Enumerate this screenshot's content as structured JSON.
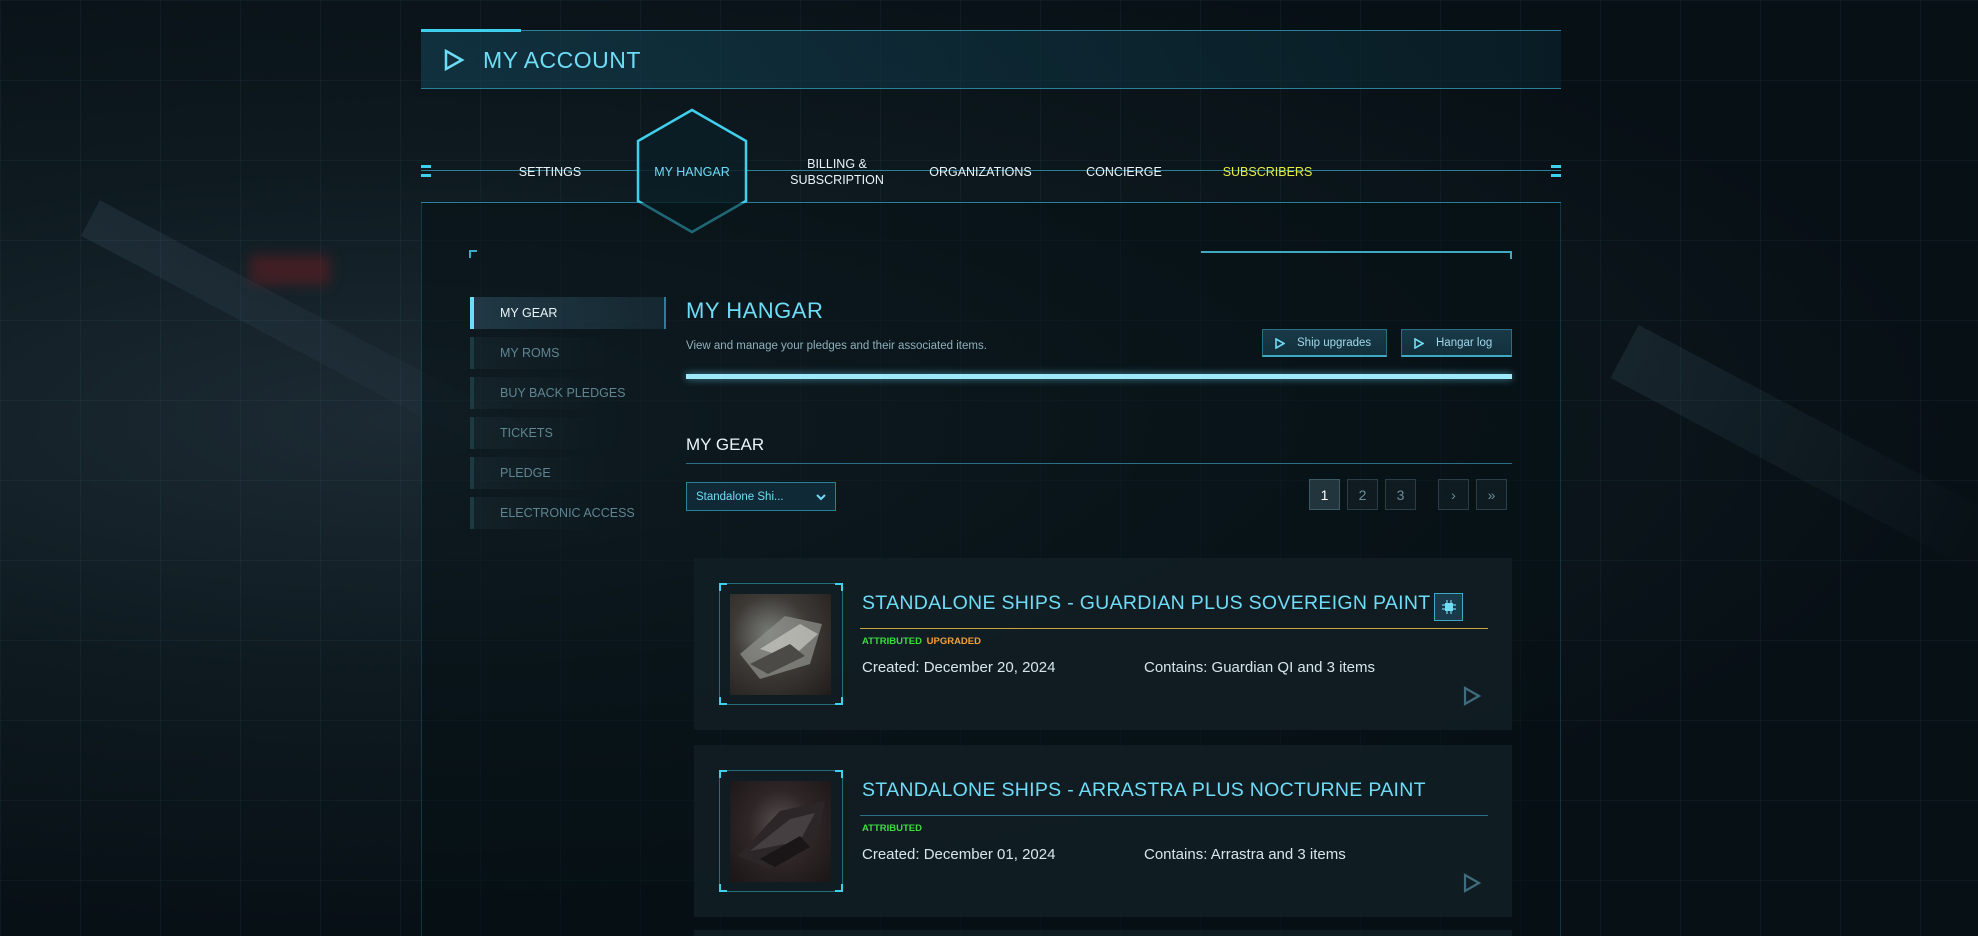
{
  "header": {
    "title": "MY ACCOUNT",
    "icon": "play-icon"
  },
  "tabs": [
    {
      "label": "SETTINGS"
    },
    {
      "label": "MY HANGAR",
      "active": true
    },
    {
      "label": "BILLING &\nSUBSCRIPTION"
    },
    {
      "label": "ORGANIZATIONS"
    },
    {
      "label": "CONCIERGE"
    },
    {
      "label": "SUBSCRIBERS"
    }
  ],
  "sidebar": {
    "items": [
      {
        "label": "MY GEAR",
        "active": true
      },
      {
        "label": "MY ROMS"
      },
      {
        "label": "BUY BACK PLEDGES"
      },
      {
        "label": "TICKETS"
      },
      {
        "label": "PLEDGE"
      },
      {
        "label": "ELECTRONIC ACCESS"
      }
    ]
  },
  "hangar": {
    "title": "MY HANGAR",
    "subtitle": "View and manage your pledges and their associated items.",
    "buttons": {
      "ship_upgrades": "Ship upgrades",
      "hangar_log": "Hangar log"
    }
  },
  "gear": {
    "title": "MY GEAR",
    "filter_selected": "Standalone Shi...",
    "pagination": {
      "pages": [
        "1",
        "2",
        "3"
      ],
      "current": "1",
      "next": "›",
      "last": "»"
    }
  },
  "pledges": [
    {
      "title": "STANDALONE SHIPS - GUARDIAN PLUS SOVEREIGN PAINT",
      "status_attributed": "ATTRIBUTED",
      "status_upgraded": "UPGRADED",
      "created": "Created: December 20, 2024",
      "contains": "Contains: Guardian QI and 3 items",
      "underline_color": "#c9a640",
      "badge_icon": "chip-icon"
    },
    {
      "title": "STANDALONE SHIPS - ARRASTRA PLUS NOCTURNE PAINT",
      "status_attributed": "ATTRIBUTED",
      "created": "Created: December 01, 2024",
      "contains": "Contains: Arrastra and 3 items",
      "underline_color": "#2a6f86"
    }
  ],
  "colors": {
    "accent": "#6fdcf6",
    "subscribers": "#e3ec3f",
    "attributed": "#3ddc3f",
    "upgraded": "#f2a03b"
  }
}
